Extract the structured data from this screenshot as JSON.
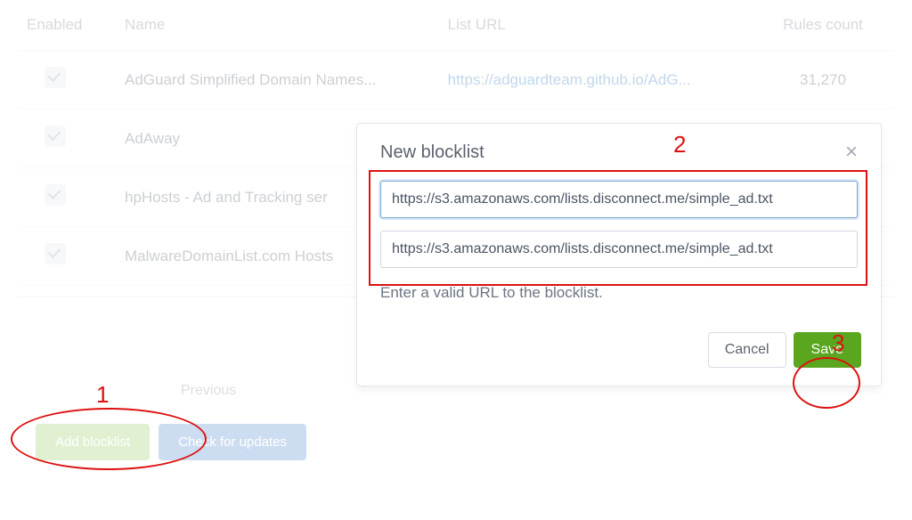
{
  "table": {
    "headers": {
      "enabled": "Enabled",
      "name": "Name",
      "list_url": "List URL",
      "rules": "Rules count"
    },
    "rows": [
      {
        "name": "AdGuard Simplified Domain Names...",
        "url": "https://adguardteam.github.io/AdG...",
        "rules": "31,270"
      },
      {
        "name": "AdAway",
        "url": "",
        "rules": ""
      },
      {
        "name": "hpHosts - Ad and Tracking ser",
        "url": "",
        "rules": ""
      },
      {
        "name": "MalwareDomainList.com Hosts",
        "url": "",
        "rules": ""
      }
    ]
  },
  "pagination": {
    "previous": "Previous"
  },
  "buttons": {
    "add": "Add blocklist",
    "check": "Check for updates"
  },
  "modal": {
    "title": "New blocklist",
    "name_value": "https://s3.amazonaws.com/lists.disconnect.me/simple_ad.txt",
    "url_value": "https://s3.amazonaws.com/lists.disconnect.me/simple_ad.txt",
    "help": "Enter a valid URL to the blocklist.",
    "cancel": "Cancel",
    "save": "Save"
  },
  "annotations": {
    "one": "1",
    "two": "2",
    "three": "3"
  }
}
